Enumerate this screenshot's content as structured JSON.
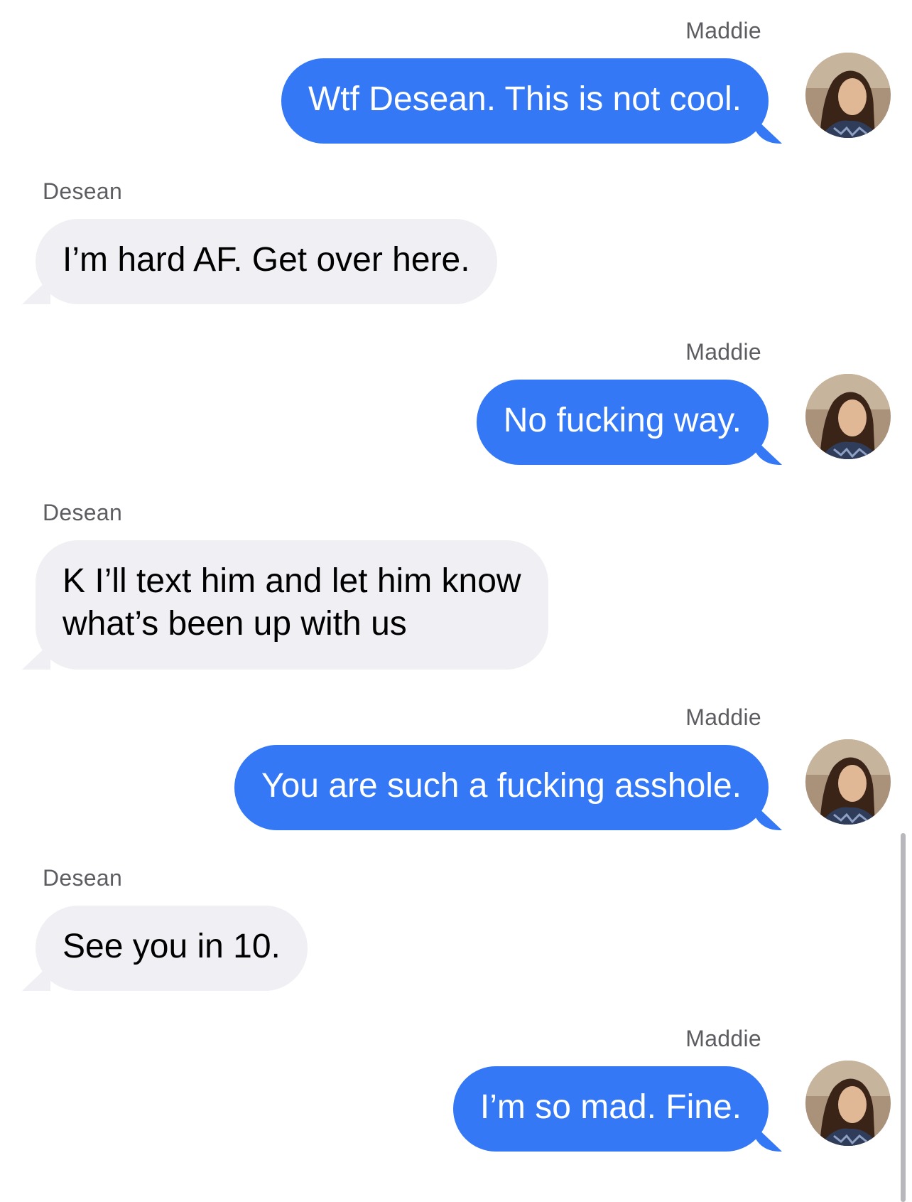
{
  "conversation": {
    "participants": {
      "me": "Maddie",
      "other": "Desean"
    },
    "messages": [
      {
        "sender": "Maddie",
        "text": "Wtf Desean. This is not cool."
      },
      {
        "sender": "Desean",
        "text": "I’m hard AF. Get over here."
      },
      {
        "sender": "Maddie",
        "text": "No fucking way."
      },
      {
        "sender": "Desean",
        "text_line1": "K I’ll text him and let him know",
        "text_line2": "what’s been up with us"
      },
      {
        "sender": "Maddie",
        "text": "You are such a fucking asshole."
      },
      {
        "sender": "Desean",
        "text": "See you in 10."
      },
      {
        "sender": "Maddie",
        "text": "I’m so mad. Fine."
      }
    ]
  },
  "colors": {
    "outgoing_bubble": "#3478f6",
    "incoming_bubble": "#efeff4",
    "sender_name": "#5c5c61"
  },
  "icons": {
    "avatar": "profile-photo-avatar"
  }
}
